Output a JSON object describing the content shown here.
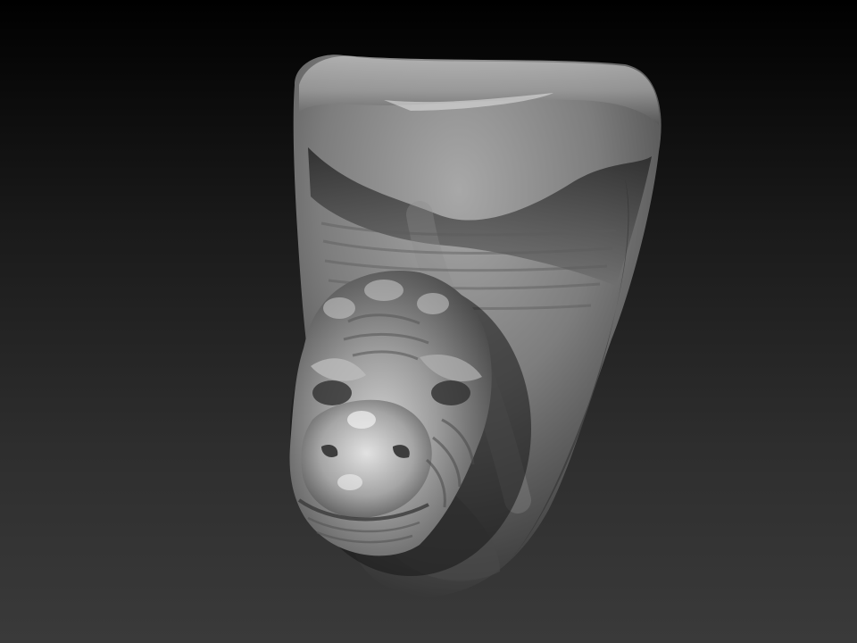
{
  "viewport": {
    "background_top": "#000000",
    "background_bottom": "#3a3a3a"
  },
  "model": {
    "subject": "sculpt-model",
    "material_base": "#8a8a8a",
    "material_highlight": "#d8d8d8",
    "material_shadow": "#1c1c1c"
  }
}
